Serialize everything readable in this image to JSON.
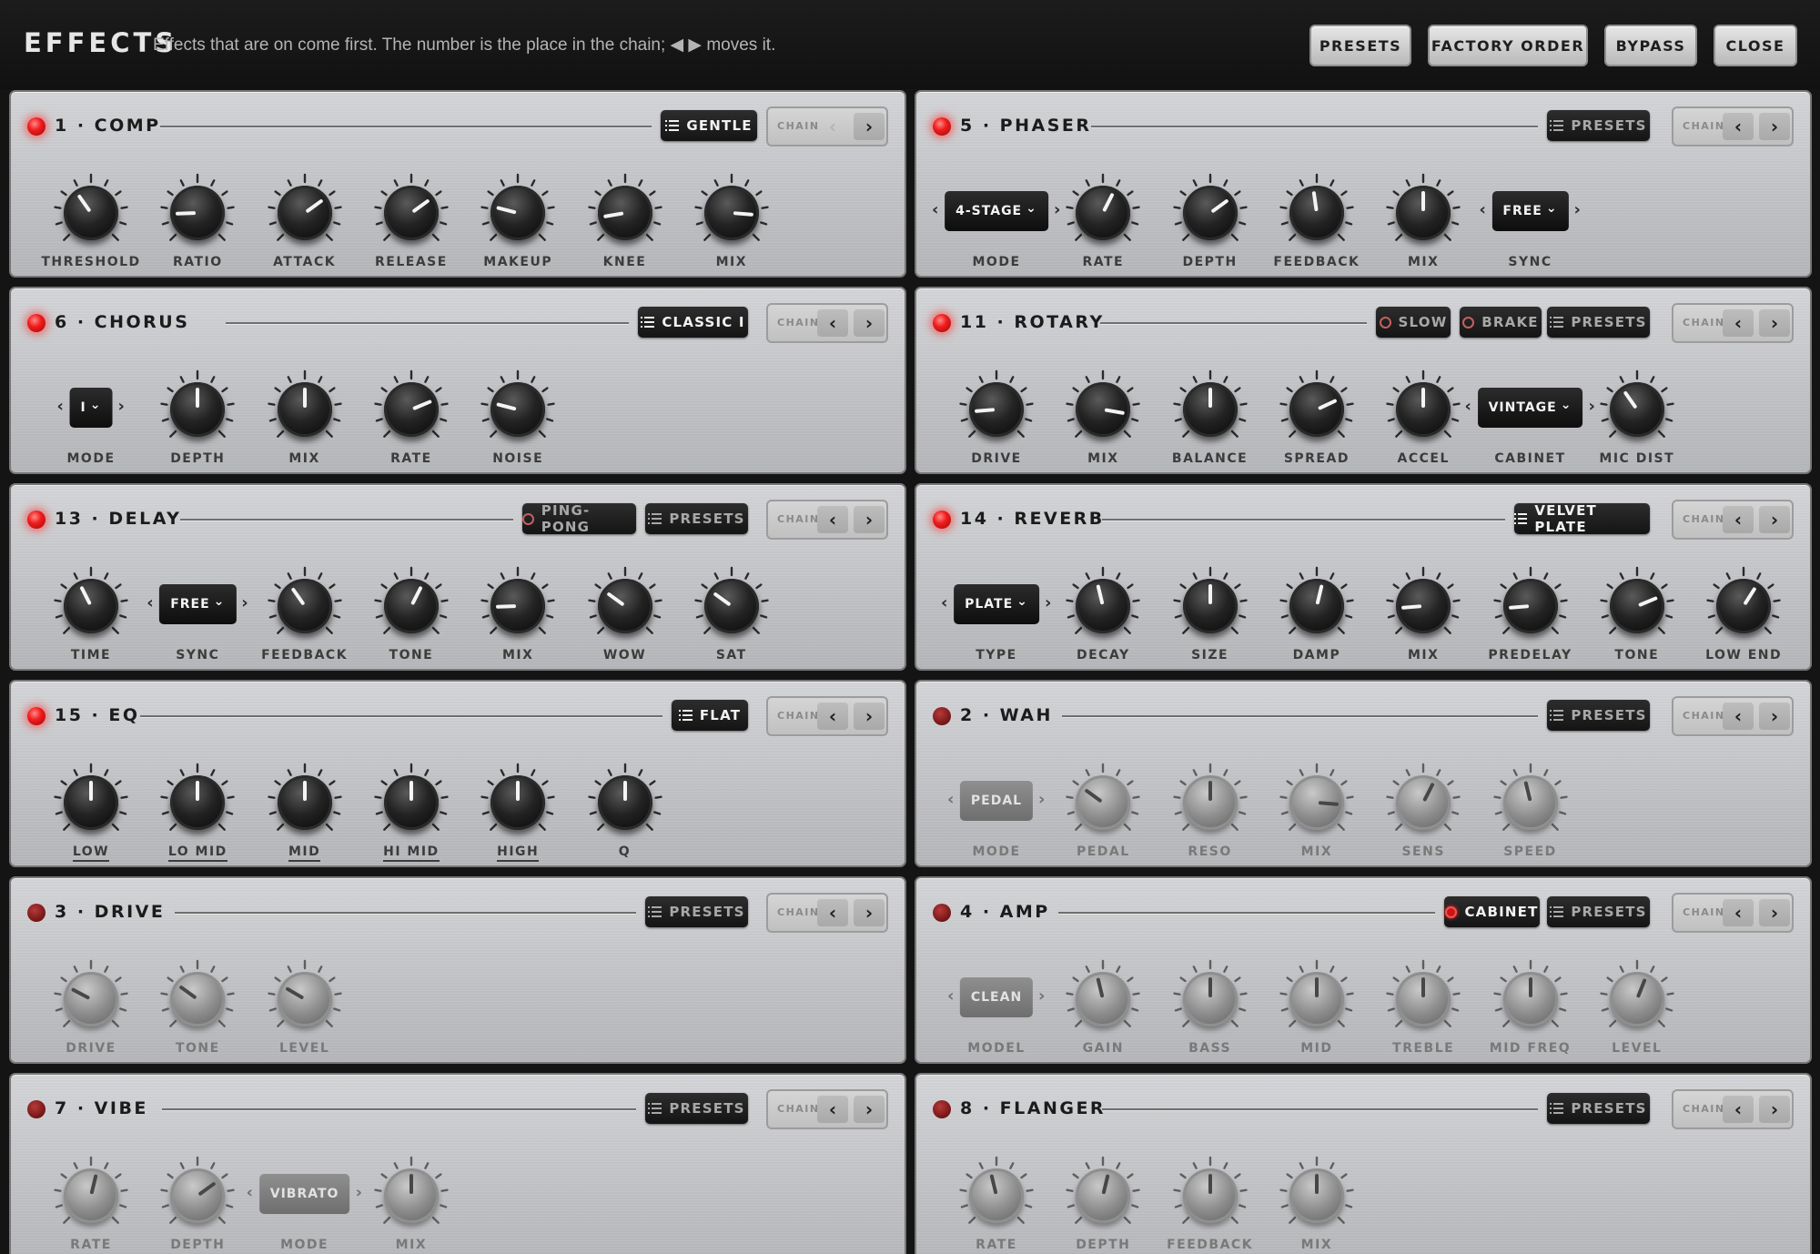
{
  "header": {
    "title": "EFFECTS",
    "subtitle": "Effects that are on come first. The number is the place in the chain; ◀ ▶ moves it.",
    "buttons": {
      "presets": "PRESETS",
      "factory_order": "FACTORY ORDER",
      "bypass": "BYPASS",
      "close": "CLOSE"
    }
  },
  "chain_label": "CHAIN",
  "icons": {
    "led": "led-icon",
    "list": "list-icon",
    "toggle": "toggle-ring-icon",
    "prev": "chevron-left-icon",
    "next": "chevron-right-icon"
  },
  "colors": {
    "led_on": "#f01d1d",
    "led_off": "#7c1a1a",
    "button_dark": "#141414",
    "panel": "#c8c9cc"
  },
  "panels": [
    {
      "key": "comp",
      "title": "1 · COMP",
      "on": true,
      "buttons": [
        {
          "type": "preset",
          "label": "GENTLE"
        }
      ],
      "controls": [
        {
          "type": "knob",
          "label": "THRESHOLD",
          "value": 0.37
        },
        {
          "type": "knob",
          "label": "RATIO",
          "value": 0.16
        },
        {
          "type": "knob",
          "label": "ATTACK",
          "value": 0.7
        },
        {
          "type": "knob",
          "label": "RELEASE",
          "value": 0.7
        },
        {
          "type": "knob",
          "label": "MAKEUP",
          "value": 0.22
        },
        {
          "type": "knob",
          "label": "KNEE",
          "value": 0.13
        },
        {
          "type": "knob",
          "label": "MIX",
          "value": 0.85
        }
      ]
    },
    {
      "key": "phaser",
      "title": "5 · PHASER",
      "on": true,
      "buttons": [
        {
          "type": "preset",
          "label": "PRESETS"
        }
      ],
      "controls": [
        {
          "type": "select",
          "label": "MODE",
          "value": "4-STAGE"
        },
        {
          "type": "knob",
          "label": "RATE",
          "value": 0.6
        },
        {
          "type": "knob",
          "label": "DEPTH",
          "value": 0.7
        },
        {
          "type": "knob",
          "label": "FEEDBACK",
          "value": 0.47
        },
        {
          "type": "knob",
          "label": "MIX",
          "value": 0.5
        },
        {
          "type": "select",
          "label": "SYNC",
          "value": "FREE"
        }
      ]
    },
    {
      "key": "chorus",
      "title": "6 · CHORUS",
      "on": true,
      "buttons": [
        {
          "type": "preset",
          "label": "CLASSIC I"
        }
      ],
      "controls": [
        {
          "type": "select",
          "label": "MODE",
          "value": "I"
        },
        {
          "type": "knob",
          "label": "DEPTH",
          "value": 0.5
        },
        {
          "type": "knob",
          "label": "MIX",
          "value": 0.5
        },
        {
          "type": "knob",
          "label": "RATE",
          "value": 0.75
        },
        {
          "type": "knob",
          "label": "NOISE",
          "value": 0.22
        }
      ]
    },
    {
      "key": "rotary",
      "title": "11 · ROTARY",
      "on": true,
      "buttons": [
        {
          "type": "toggle",
          "label": "SLOW",
          "active": false
        },
        {
          "type": "toggle",
          "label": "BRAKE",
          "active": false
        },
        {
          "type": "preset",
          "label": "PRESETS"
        }
      ],
      "controls": [
        {
          "type": "knob",
          "label": "DRIVE",
          "value": 0.15
        },
        {
          "type": "knob",
          "label": "MIX",
          "value": 0.87
        },
        {
          "type": "knob",
          "label": "BALANCE",
          "value": 0.5
        },
        {
          "type": "knob",
          "label": "SPREAD",
          "value": 0.74
        },
        {
          "type": "knob",
          "label": "ACCEL",
          "value": 0.5
        },
        {
          "type": "select",
          "label": "CABINET",
          "value": "VINTAGE"
        },
        {
          "type": "knob",
          "label": "MIC DIST",
          "value": 0.37
        }
      ]
    },
    {
      "key": "delay",
      "title": "13 · DELAY",
      "on": true,
      "buttons": [
        {
          "type": "toggle",
          "label": "PING-PONG",
          "active": false
        },
        {
          "type": "preset",
          "label": "PRESETS"
        }
      ],
      "controls": [
        {
          "type": "knob",
          "label": "TIME",
          "value": 0.4
        },
        {
          "type": "select",
          "label": "SYNC",
          "value": "FREE"
        },
        {
          "type": "knob",
          "label": "FEEDBACK",
          "value": 0.37
        },
        {
          "type": "knob",
          "label": "TONE",
          "value": 0.6
        },
        {
          "type": "knob",
          "label": "MIX",
          "value": 0.16
        },
        {
          "type": "knob",
          "label": "WOW",
          "value": 0.3
        },
        {
          "type": "knob",
          "label": "SAT",
          "value": 0.3
        }
      ]
    },
    {
      "key": "reverb",
      "title": "14 · REVERB",
      "on": true,
      "buttons": [
        {
          "type": "preset",
          "label": "VELVET PLATE"
        }
      ],
      "controls": [
        {
          "type": "select",
          "label": "TYPE",
          "value": "PLATE"
        },
        {
          "type": "knob",
          "label": "DECAY",
          "value": 0.45
        },
        {
          "type": "knob",
          "label": "SIZE",
          "value": 0.5
        },
        {
          "type": "knob",
          "label": "DAMP",
          "value": 0.55
        },
        {
          "type": "knob",
          "label": "MIX",
          "value": 0.15
        },
        {
          "type": "knob",
          "label": "PREDELAY",
          "value": 0.15
        },
        {
          "type": "knob",
          "label": "TONE",
          "value": 0.75
        },
        {
          "type": "knob",
          "label": "LOW END",
          "value": 0.62
        }
      ]
    },
    {
      "key": "eq",
      "title": "15 · EQ",
      "on": true,
      "buttons": [
        {
          "type": "preset",
          "label": "FLAT"
        }
      ],
      "controls": [
        {
          "type": "knob",
          "label": "LOW",
          "value": 0.5,
          "underline": true
        },
        {
          "type": "knob",
          "label": "LO MID",
          "value": 0.5,
          "underline": true
        },
        {
          "type": "knob",
          "label": "MID",
          "value": 0.5,
          "underline": true
        },
        {
          "type": "knob",
          "label": "HI MID",
          "value": 0.5,
          "underline": true
        },
        {
          "type": "knob",
          "label": "HIGH",
          "value": 0.5,
          "underline": true
        },
        {
          "type": "knob",
          "label": "Q",
          "value": 0.5
        }
      ]
    },
    {
      "key": "wah",
      "title": "2 · WAH",
      "on": false,
      "buttons": [
        {
          "type": "preset",
          "label": "PRESETS"
        }
      ],
      "controls": [
        {
          "type": "select",
          "label": "MODE",
          "value": "PEDAL"
        },
        {
          "type": "knob",
          "label": "PEDAL",
          "value": 0.3
        },
        {
          "type": "knob",
          "label": "RESO",
          "value": 0.5
        },
        {
          "type": "knob",
          "label": "MIX",
          "value": 0.85
        },
        {
          "type": "knob",
          "label": "SENS",
          "value": 0.6
        },
        {
          "type": "knob",
          "label": "SPEED",
          "value": 0.45
        }
      ]
    },
    {
      "key": "drive",
      "title": "3 · DRIVE",
      "on": false,
      "buttons": [
        {
          "type": "preset",
          "label": "PRESETS"
        }
      ],
      "controls": [
        {
          "type": "knob",
          "label": "DRIVE",
          "value": 0.27
        },
        {
          "type": "knob",
          "label": "TONE",
          "value": 0.3
        },
        {
          "type": "knob",
          "label": "LEVEL",
          "value": 0.28
        }
      ]
    },
    {
      "key": "amp",
      "title": "4 · AMP",
      "on": false,
      "buttons": [
        {
          "type": "toggle",
          "label": "CABINET",
          "active": true
        },
        {
          "type": "preset",
          "label": "PRESETS"
        }
      ],
      "controls": [
        {
          "type": "select",
          "label": "MODEL",
          "value": "CLEAN"
        },
        {
          "type": "knob",
          "label": "GAIN",
          "value": 0.45
        },
        {
          "type": "knob",
          "label": "BASS",
          "value": 0.5
        },
        {
          "type": "knob",
          "label": "MID",
          "value": 0.5
        },
        {
          "type": "knob",
          "label": "TREBLE",
          "value": 0.5
        },
        {
          "type": "knob",
          "label": "MID FREQ",
          "value": 0.5
        },
        {
          "type": "knob",
          "label": "LEVEL",
          "value": 0.58
        }
      ]
    },
    {
      "key": "vibe",
      "title": "7 · VIBE",
      "on": false,
      "buttons": [
        {
          "type": "preset",
          "label": "PRESETS"
        }
      ],
      "controls": [
        {
          "type": "knob",
          "label": "RATE",
          "value": 0.55
        },
        {
          "type": "knob",
          "label": "DEPTH",
          "value": 0.7
        },
        {
          "type": "select",
          "label": "MODE",
          "value": "VIBRATO"
        },
        {
          "type": "knob",
          "label": "MIX",
          "value": 0.5
        }
      ]
    },
    {
      "key": "flanger",
      "title": "8 · FLANGER",
      "on": false,
      "buttons": [
        {
          "type": "preset",
          "label": "PRESETS"
        }
      ],
      "controls": [
        {
          "type": "knob",
          "label": "RATE",
          "value": 0.45
        },
        {
          "type": "knob",
          "label": "DEPTH",
          "value": 0.55
        },
        {
          "type": "knob",
          "label": "FEEDBACK",
          "value": 0.5
        },
        {
          "type": "knob",
          "label": "MIX",
          "value": 0.5
        }
      ]
    }
  ]
}
